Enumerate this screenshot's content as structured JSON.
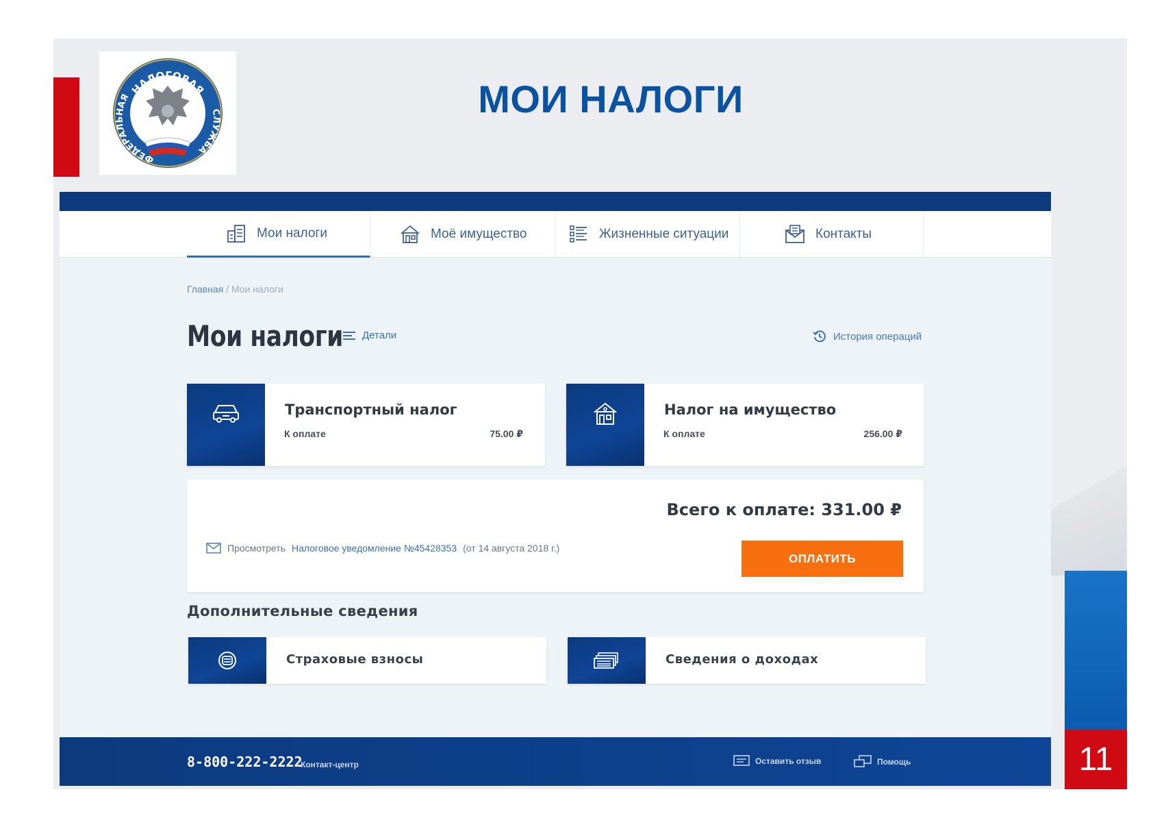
{
  "slide": {
    "title": "МОИ НАЛОГИ",
    "page_number": "11",
    "logo_text_top": "НАЛОГОВАЯ",
    "logo_text_left": "ФЕДЕРАЛЬНАЯ",
    "logo_text_right": "СЛУЖБА"
  },
  "nav": {
    "tabs": [
      {
        "label": "Мои налоги",
        "icon": "tax-document-icon",
        "active": true
      },
      {
        "label": "Моё имущество",
        "icon": "house-icon",
        "active": false
      },
      {
        "label": "Жизненные ситуации",
        "icon": "list-icon",
        "active": false
      },
      {
        "label": "Контакты",
        "icon": "envelope-icon",
        "active": false
      }
    ]
  },
  "breadcrumb": {
    "home": "Главная",
    "separator": "/",
    "current": "Мои налоги"
  },
  "page": {
    "title": "Мои налоги",
    "details_label": "Детали",
    "history_label": "История операций"
  },
  "taxes": [
    {
      "title": "Транспортный налог",
      "sub": "К оплате",
      "amount": "75.00 ₽",
      "icon": "car-icon"
    },
    {
      "title": "Налог на имущество",
      "sub": "К оплате",
      "amount": "256.00 ₽",
      "icon": "house-icon"
    }
  ],
  "total": {
    "label": "Всего к оплате: 331.00 ₽",
    "notice_prefix": "Просмотреть",
    "notice_link": "Налоговое уведомление №45428353",
    "notice_suffix": "(от 14 августа 2018 г.)",
    "pay_label": "ОПЛАТИТЬ"
  },
  "additional": {
    "title": "Дополнительные сведения",
    "items": [
      {
        "label": "Страховые взносы",
        "icon": "insurance-icon"
      },
      {
        "label": "Сведения о доходах",
        "icon": "money-icon"
      }
    ]
  },
  "footer": {
    "phone": "8-800-222-2222",
    "phone_label": "Контакт-центр",
    "feedback_label": "Оставить отзыв",
    "help_label": "Помощь"
  },
  "colors": {
    "brand_blue": "#0b52a0",
    "navy": "#0d3a7c",
    "pay_orange": "#f86f10",
    "accent_red": "#d00a12"
  }
}
